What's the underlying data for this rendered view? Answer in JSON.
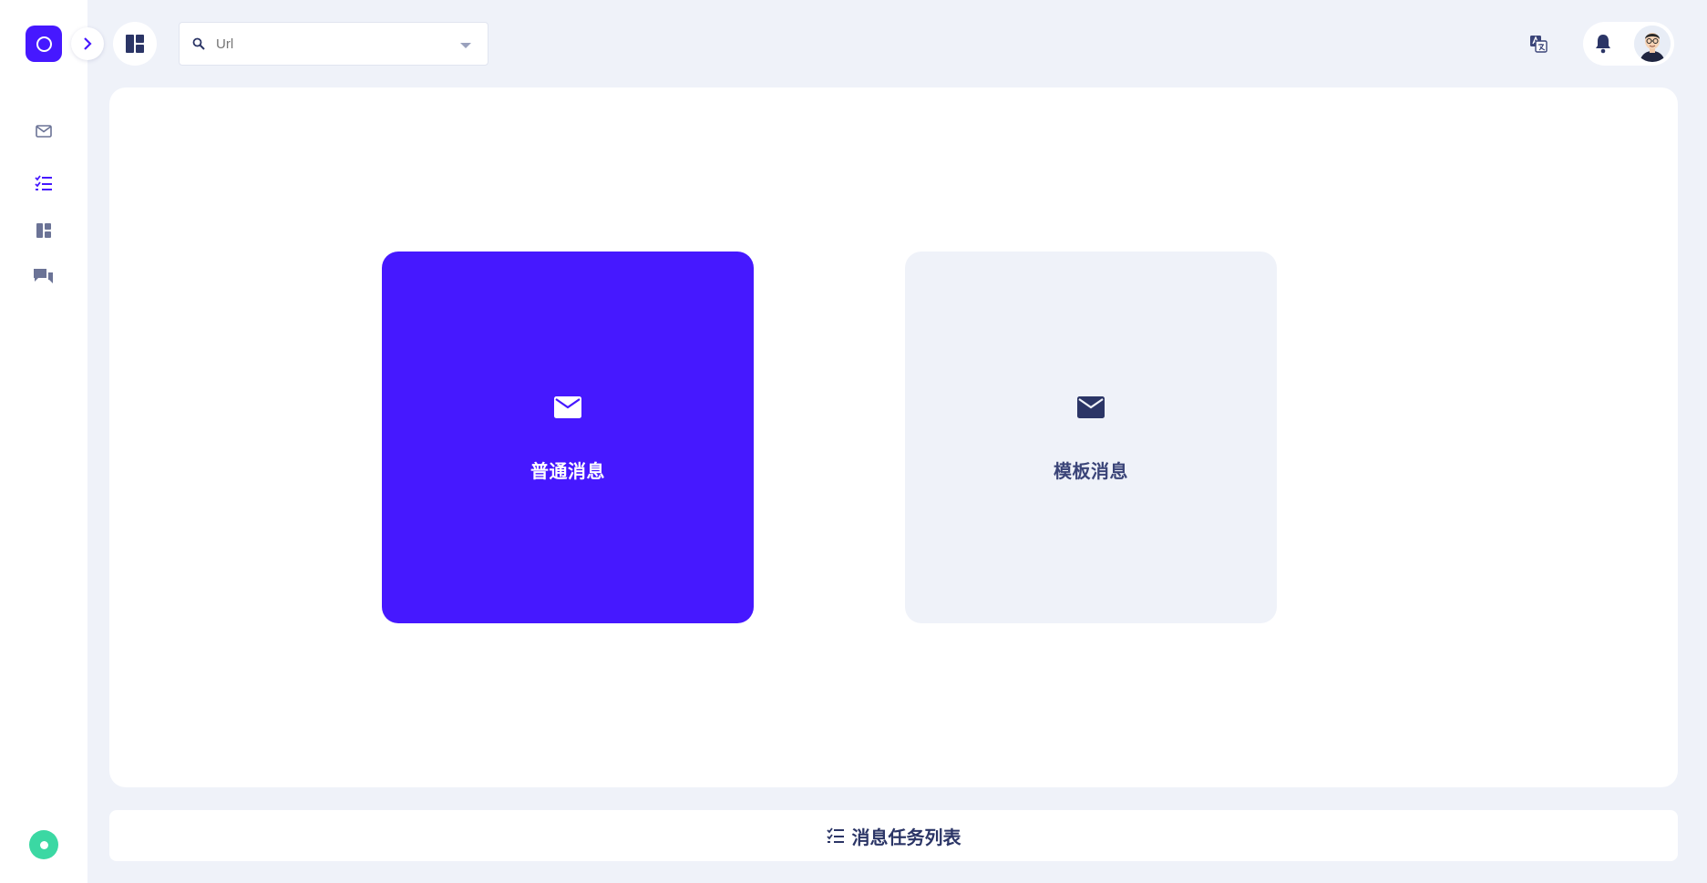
{
  "topbar": {
    "url_placeholder": "Url",
    "url_value": ""
  },
  "sidebar": {
    "items": [
      {
        "icon": "mail-icon",
        "active": false
      },
      {
        "icon": "checklist-icon",
        "active": true
      },
      {
        "icon": "dashboard-icon",
        "active": false
      },
      {
        "icon": "chat-icon",
        "active": false
      }
    ],
    "status": "online"
  },
  "main": {
    "options": [
      {
        "label": "普通消息",
        "icon": "mail-icon",
        "selected": true
      },
      {
        "label": "模板消息",
        "icon": "mail-icon",
        "selected": false
      }
    ]
  },
  "bottom": {
    "label": "消息任务列表",
    "icon": "checklist-icon"
  },
  "colors": {
    "accent": "#4618ff",
    "background": "#eff2f9",
    "text_dark": "#2b3566",
    "status_green": "#3bd8a3"
  }
}
